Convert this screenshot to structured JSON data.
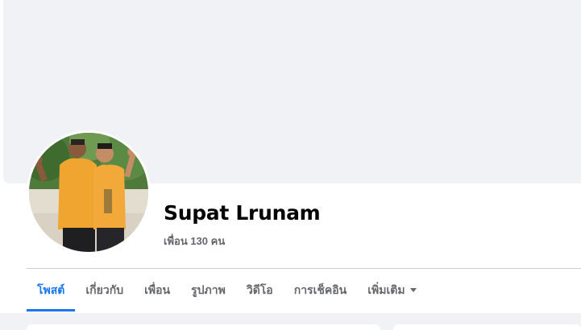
{
  "profile": {
    "name": "Supat Lrunam",
    "friends_text": "เพื่อน 130 คน"
  },
  "tabs": [
    {
      "label": "โพสต์",
      "active": true
    },
    {
      "label": "เกี่ยวกับ",
      "active": false
    },
    {
      "label": "เพื่อน",
      "active": false
    },
    {
      "label": "รูปภาพ",
      "active": false
    },
    {
      "label": "วิดีโอ",
      "active": false
    },
    {
      "label": "การเช็คอิน",
      "active": false
    },
    {
      "label": "เพิ่มเติม",
      "active": false
    }
  ],
  "colors": {
    "accent": "#1877f2",
    "cover": "#f0f2f5",
    "name": "#050505",
    "muted": "#65676b"
  },
  "icons": {
    "more_tab": "caret-down-icon"
  }
}
